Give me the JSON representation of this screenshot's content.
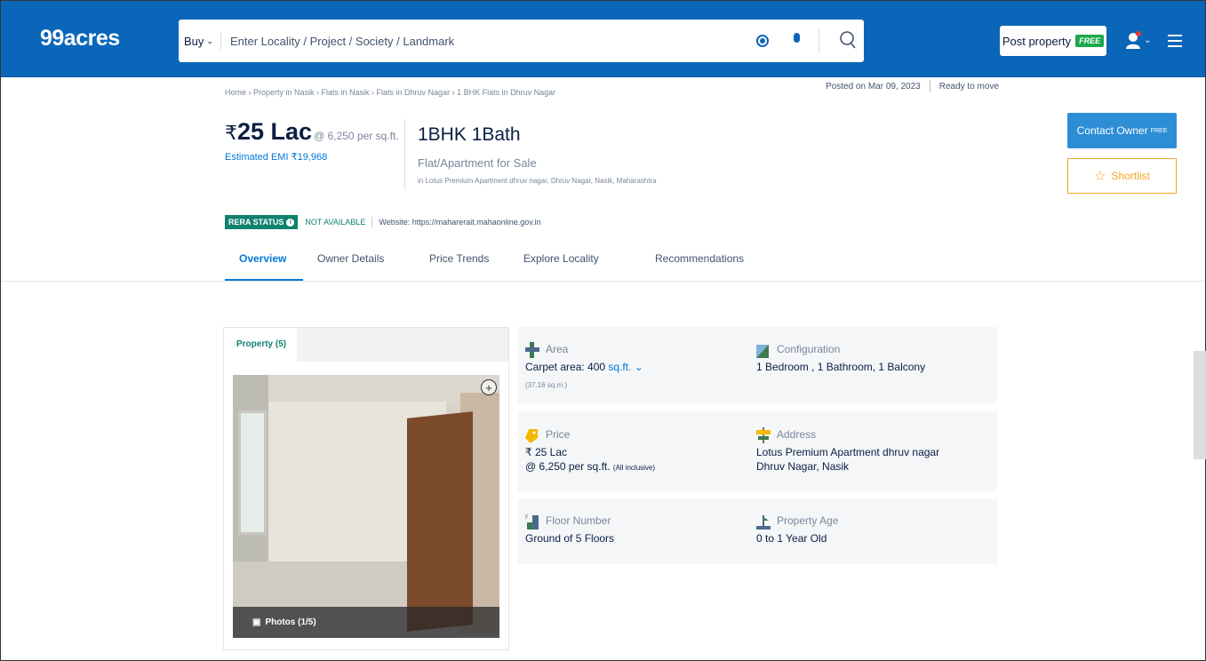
{
  "header": {
    "logo": "99acres",
    "search": {
      "mode": "Buy",
      "placeholder": "Enter Locality / Project / Society / Landmark"
    },
    "post_property": "Post property",
    "post_badge": "FREE"
  },
  "listing": {
    "breadcrumb": "Home › Property in Nasik › Flats in Nasik › Flats in Dhruv Nagar › 1 BHK Flats in Dhruv Nagar",
    "posted_on": "Posted on Mar 09, 2023",
    "status": "Ready to move",
    "price_symbol": "₹",
    "price_amount": "25 Lac",
    "price_per_sqft": "@ 6,250 per sq.ft.",
    "emi": "Estimated EMI ₹19,968",
    "title": "1BHK 1Bath",
    "subtitle": "Flat/Apartment for Sale",
    "location_line": "in Lotus Premium Apartment dhruv nagar, Dhruv Nagar, Nasik, Maharashtra",
    "contact_button": "Contact Owner",
    "contact_badge": "FREE",
    "shortlist_button": "Shortlist",
    "rera_label": "RERA STATUS",
    "rera_value": "NOT AVAILABLE",
    "rera_website": "Website: https://maharerait.mahaonline.gov.in"
  },
  "tabs": [
    {
      "label": "Overview",
      "active": true
    },
    {
      "label": "Owner Details",
      "active": false
    },
    {
      "label": "Price Trends",
      "active": false
    },
    {
      "label": "Explore Locality",
      "active": false
    },
    {
      "label": "Recommendations",
      "active": false
    }
  ],
  "gallery": {
    "tab_label": "Property (5)",
    "photos_label": "Photos (1/5)"
  },
  "details": {
    "area": {
      "label": "Area",
      "value": "Carpet area: 400",
      "unit": "sq.ft.",
      "sub": "(37.16 sq.m.)"
    },
    "configuration": {
      "label": "Configuration",
      "value": "1 Bedroom , 1 Bathroom, 1 Balcony"
    },
    "price": {
      "label": "Price",
      "value": "₹ 25 Lac",
      "value2": "@ 6,250 per sq.ft.",
      "note": "(All inclusive)"
    },
    "address": {
      "label": "Address",
      "line1": "Lotus Premium Apartment dhruv nagar",
      "line2": "Dhruv Nagar, Nasik"
    },
    "floor": {
      "label": "Floor Number",
      "value": "Ground of 5 Floors"
    },
    "age": {
      "label": "Property Age",
      "value": "0 to 1 Year Old"
    }
  },
  "colors": {
    "brand_blue": "#0A66B9",
    "link_blue": "#0078DB",
    "rera_green": "#10826E",
    "shortlist_orange": "#F5A623"
  }
}
